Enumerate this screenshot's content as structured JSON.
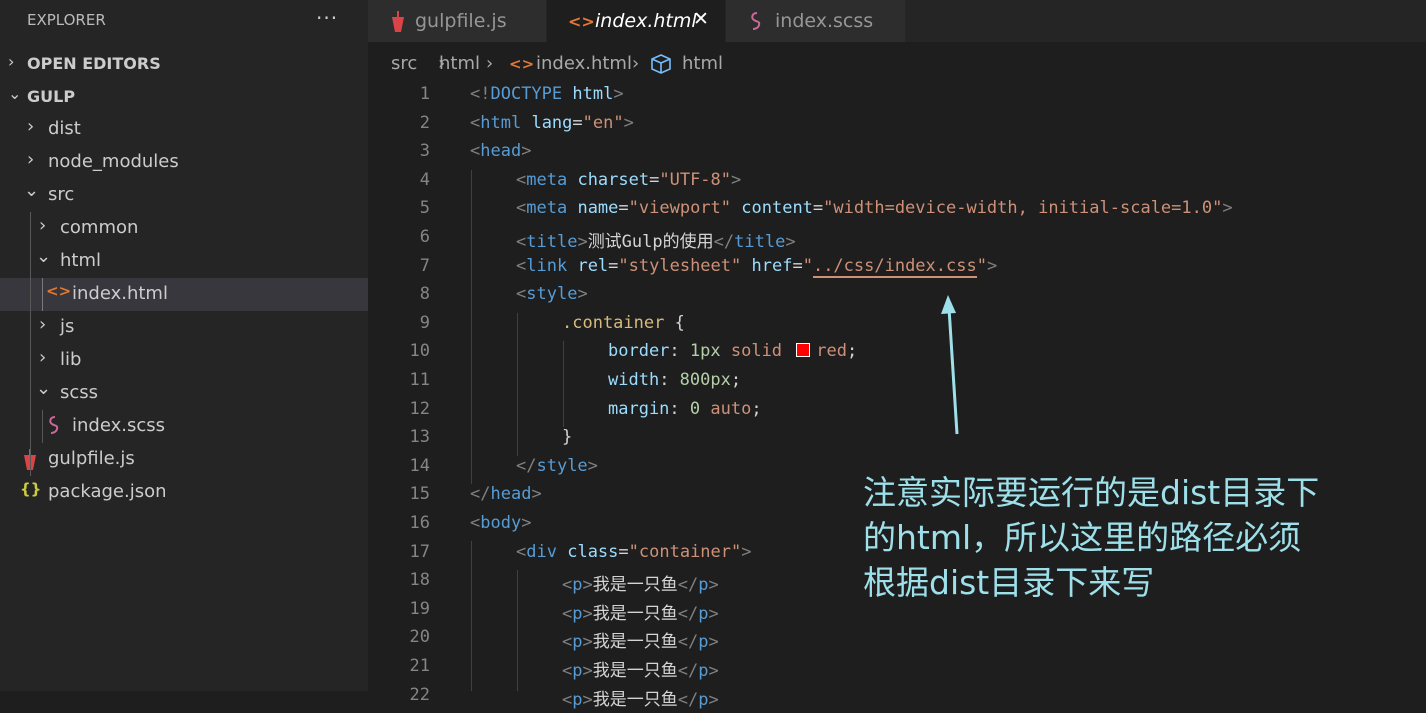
{
  "sidebar": {
    "title": "EXPLORER",
    "more": "···",
    "open_editors": "OPEN EDITORS",
    "workspace": "GULP",
    "items": [
      {
        "label": "dist"
      },
      {
        "label": "node_modules"
      },
      {
        "label": "src"
      },
      {
        "label": "common"
      },
      {
        "label": "html"
      },
      {
        "label": "index.html"
      },
      {
        "label": "js"
      },
      {
        "label": "lib"
      },
      {
        "label": "scss"
      },
      {
        "label": "index.scss"
      },
      {
        "label": "gulpfile.js"
      },
      {
        "label": "package.json"
      }
    ],
    "icons": {
      "html": "<>",
      "json": "{}"
    }
  },
  "tabs": [
    {
      "label": "gulpfile.js"
    },
    {
      "label": "index.html",
      "close": "✕"
    },
    {
      "label": "index.scss"
    }
  ],
  "breadcrumbs": [
    "src",
    "html",
    "index.html",
    "html"
  ],
  "editor": {
    "l1": {
      "n": "1",
      "a": "<!",
      "b": "DOCTYPE",
      "c": "html",
      "d": ">"
    },
    "l2": {
      "n": "2",
      "a": "<",
      "b": "html",
      "c": "lang",
      "d": "=",
      "e": "\"en\"",
      "f": ">"
    },
    "l3": {
      "n": "3",
      "a": "<",
      "b": "head",
      "c": ">"
    },
    "l4": {
      "n": "4",
      "a": "<",
      "b": "meta",
      "c": "charset",
      "d": "=",
      "e": "\"UTF-8\"",
      "f": ">"
    },
    "l5": {
      "n": "5",
      "a": "<",
      "b": "meta",
      "c": "name",
      "d": "=",
      "e": "\"viewport\"",
      "g": "content",
      "h": "=",
      "i": "\"width=device-width, initial-scale=1.0\"",
      "f": ">"
    },
    "l6": {
      "n": "6",
      "a": "<",
      "b": "title",
      "c": ">",
      "t": "测试Gulp的使用",
      "d": "</",
      "e": "title",
      "f": ">"
    },
    "l7": {
      "n": "7",
      "a": "<",
      "b": "link",
      "c": "rel",
      "d": "=",
      "e": "\"stylesheet\"",
      "g": "href",
      "h": "=",
      "q1": "\"",
      "i": "../css/index.css",
      "q2": "\"",
      "f": ">"
    },
    "l8": {
      "n": "8",
      "a": "<",
      "b": "style",
      "c": ">"
    },
    "l9": {
      "n": "9",
      "a": ".container",
      "b": " {"
    },
    "l10": {
      "n": "10",
      "a": "border",
      "b": ": ",
      "c": "1px",
      "d": " solid ",
      "e": "red",
      "f": ";"
    },
    "l11": {
      "n": "11",
      "a": "width",
      "b": ": ",
      "c": "800px",
      "f": ";"
    },
    "l12": {
      "n": "12",
      "a": "margin",
      "b": ": ",
      "c": "0",
      "d": " auto",
      "f": ";"
    },
    "l13": {
      "n": "13",
      "a": "}"
    },
    "l14": {
      "n": "14",
      "a": "</",
      "b": "style",
      "c": ">"
    },
    "l15": {
      "n": "15",
      "a": "</",
      "b": "head",
      "c": ">"
    },
    "l16": {
      "n": "16",
      "a": "<",
      "b": "body",
      "c": ">"
    },
    "l17": {
      "n": "17",
      "a": "<",
      "b": "div",
      "c": "class",
      "d": "=",
      "e": "\"container\"",
      "f": ">"
    },
    "lp": {
      "a": "<",
      "b": "p",
      "c": ">",
      "t": "我是一只鱼",
      "d": "</",
      "e": "p",
      "f": ">"
    },
    "pnums": [
      "18",
      "19",
      "20",
      "21",
      "22"
    ]
  },
  "annotation": [
    "注意实际要运行的是dist目录下",
    "的html，所以这里的路径必须",
    "根据dist目录下来写"
  ],
  "colors": {
    "annotation": "#9ee0ea",
    "tag": "#569cd6",
    "attr": "#9cdcfe",
    "string": "#ce9178"
  }
}
